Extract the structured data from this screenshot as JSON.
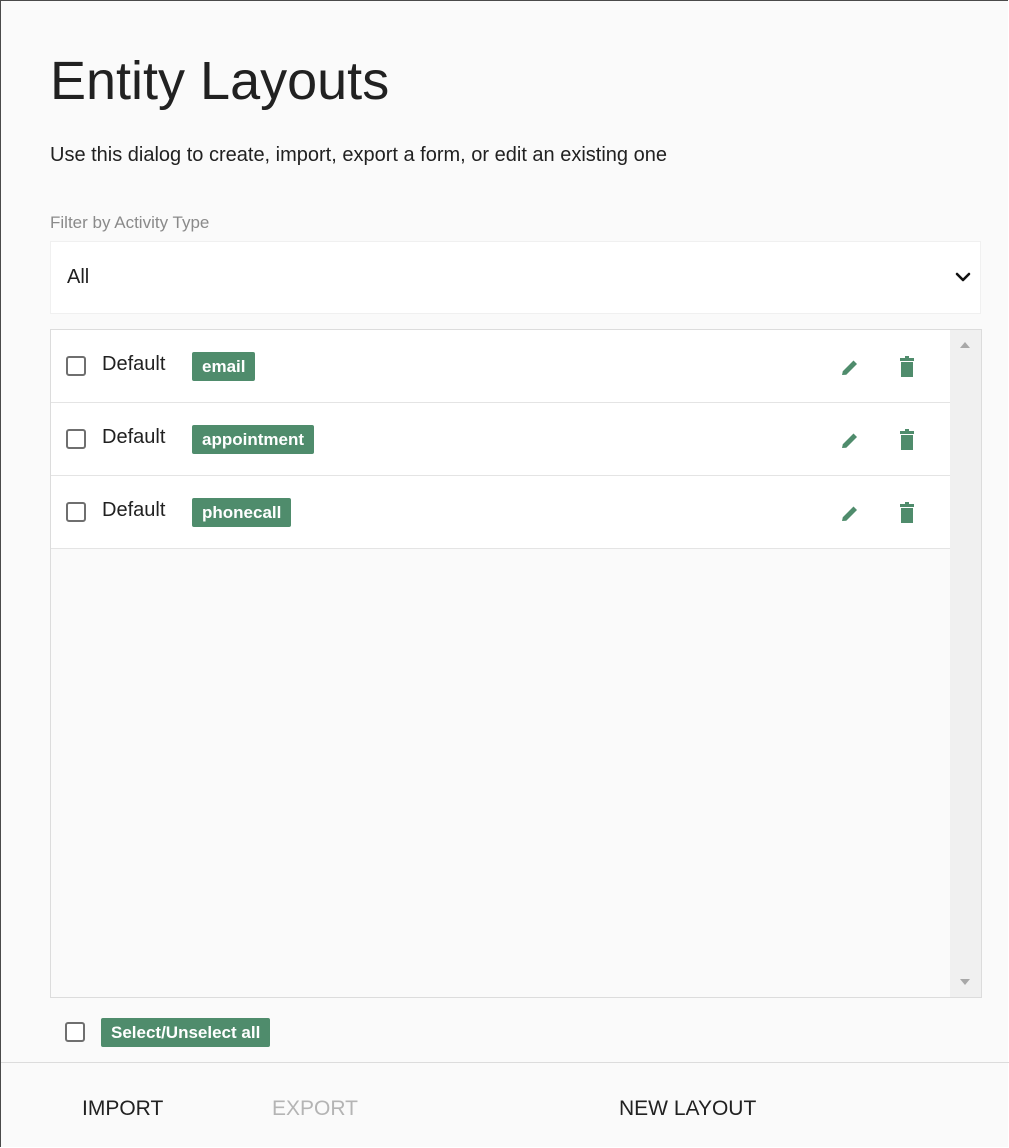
{
  "dialog": {
    "title": "Entity Layouts",
    "subtitle": "Use this dialog to create, import, export a form, or edit an existing one"
  },
  "filter": {
    "label": "Filter by Activity Type",
    "selected": "All"
  },
  "layouts": [
    {
      "name": "Default",
      "tag": "email"
    },
    {
      "name": "Default",
      "tag": "appointment"
    },
    {
      "name": "Default",
      "tag": "phonecall"
    }
  ],
  "select_all": {
    "label": "Select/Unselect all"
  },
  "footer": {
    "import_label": "IMPORT",
    "export_label": "EXPORT",
    "new_layout_label": "NEW LAYOUT"
  },
  "colors": {
    "accent": "#4f8c6c",
    "disabled_text": "#b4b4b4"
  },
  "icons": {
    "edit": "pencil-icon",
    "delete": "trash-icon",
    "dropdown": "chevron-down-icon"
  }
}
